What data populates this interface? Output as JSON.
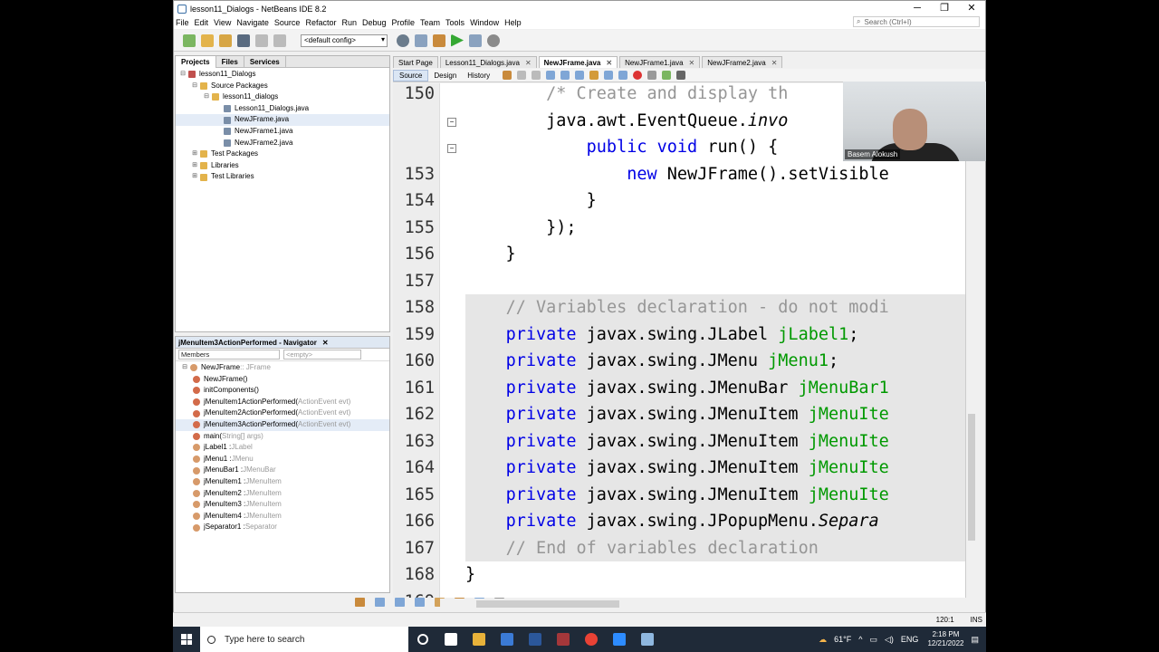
{
  "window": {
    "title": "lesson11_Dialogs - NetBeans IDE 8.2",
    "search_placeholder": "Search (Ctrl+I)"
  },
  "menu": [
    "File",
    "Edit",
    "View",
    "Navigate",
    "Source",
    "Refactor",
    "Run",
    "Debug",
    "Profile",
    "Team",
    "Tools",
    "Window",
    "Help"
  ],
  "toolbar": {
    "config": "<default config>"
  },
  "projects_panel": {
    "tabs": [
      "Projects",
      "Files",
      "Services"
    ],
    "tree": [
      {
        "label": "lesson11_Dialogs",
        "indent": 0,
        "fold": "⊟",
        "icon": "project-icon"
      },
      {
        "label": "Source Packages",
        "indent": 1,
        "fold": "⊟",
        "icon": "folder-icon"
      },
      {
        "label": "lesson11_dialogs",
        "indent": 2,
        "fold": "⊟",
        "icon": "package-icon"
      },
      {
        "label": "Lesson11_Dialogs.java",
        "indent": 3,
        "fold": "",
        "icon": "java-file-icon"
      },
      {
        "label": "NewJFrame.java",
        "indent": 3,
        "fold": "",
        "icon": "form-file-icon",
        "selected": true
      },
      {
        "label": "NewJFrame1.java",
        "indent": 3,
        "fold": "",
        "icon": "form-file-icon"
      },
      {
        "label": "NewJFrame2.java",
        "indent": 3,
        "fold": "",
        "icon": "form-file-icon"
      },
      {
        "label": "Test Packages",
        "indent": 1,
        "fold": "⊞",
        "icon": "folder-icon"
      },
      {
        "label": "Libraries",
        "indent": 1,
        "fold": "⊞",
        "icon": "library-icon"
      },
      {
        "label": "Test Libraries",
        "indent": 1,
        "fold": "⊞",
        "icon": "library-icon"
      }
    ]
  },
  "navigator": {
    "title": "jMenuItem3ActionPerformed - Navigator",
    "filter": "Members",
    "search_placeholder": "<empty>",
    "items": [
      {
        "name": "NewJFrame",
        "type": " :: JFrame",
        "indent": 0
      },
      {
        "name": "NewJFrame()",
        "type": "",
        "indent": 1
      },
      {
        "name": "initComponents()",
        "type": "",
        "indent": 1
      },
      {
        "name": "jMenuItem1ActionPerformed(",
        "type": "ActionEvent evt)",
        "indent": 1
      },
      {
        "name": "jMenuItem2ActionPerformed(",
        "type": "ActionEvent evt)",
        "indent": 1
      },
      {
        "name": "jMenuItem3ActionPerformed(",
        "type": "ActionEvent evt)",
        "indent": 1,
        "selected": true
      },
      {
        "name": "main(",
        "type": "String[] args)",
        "indent": 1
      },
      {
        "name": "jLabel1 : ",
        "type": "JLabel",
        "indent": 1
      },
      {
        "name": "jMenu1 : ",
        "type": "JMenu",
        "indent": 1
      },
      {
        "name": "jMenuBar1 : ",
        "type": "JMenuBar",
        "indent": 1
      },
      {
        "name": "jMenuItem1 : ",
        "type": "JMenuItem",
        "indent": 1
      },
      {
        "name": "jMenuItem2 : ",
        "type": "JMenuItem",
        "indent": 1
      },
      {
        "name": "jMenuItem3 : ",
        "type": "JMenuItem",
        "indent": 1
      },
      {
        "name": "jMenuItem4 : ",
        "type": "JMenuItem",
        "indent": 1
      },
      {
        "name": "jSeparator1 : ",
        "type": "Separator",
        "indent": 1
      }
    ]
  },
  "editor": {
    "tabs": [
      {
        "label": "Start Page",
        "close": false
      },
      {
        "label": "Lesson11_Dialogs.java",
        "close": true
      },
      {
        "label": "NewJFrame.java",
        "close": true,
        "active": true
      },
      {
        "label": "NewJFrame1.java",
        "close": true
      },
      {
        "label": "NewJFrame2.java",
        "close": true
      }
    ],
    "views": [
      "Source",
      "Design",
      "History"
    ],
    "lines": [
      {
        "n": "150",
        "hl": false,
        "parts": [
          [
            "",
            "        "
          ],
          [
            "cm",
            "/* Create and display th"
          ]
        ]
      },
      {
        "n": "",
        "hl": false,
        "parts": [
          [
            "",
            "        java.awt.EventQueue."
          ],
          [
            "it",
            "invo"
          ]
        ]
      },
      {
        "n": "",
        "hl": false,
        "parts": [
          [
            "",
            "            "
          ],
          [
            "kw",
            "public void "
          ],
          [
            "",
            "run() {"
          ]
        ]
      },
      {
        "n": "153",
        "hl": false,
        "parts": [
          [
            "",
            "                "
          ],
          [
            "kw",
            "new "
          ],
          [
            "",
            "NewJFrame().setVisible"
          ]
        ]
      },
      {
        "n": "154",
        "hl": false,
        "parts": [
          [
            "",
            "            }"
          ]
        ]
      },
      {
        "n": "155",
        "hl": false,
        "parts": [
          [
            "",
            "        });"
          ]
        ]
      },
      {
        "n": "156",
        "hl": false,
        "parts": [
          [
            "",
            "    }"
          ]
        ]
      },
      {
        "n": "157",
        "hl": false,
        "parts": [
          [
            "",
            ""
          ]
        ]
      },
      {
        "n": "158",
        "hl": true,
        "parts": [
          [
            "",
            "    "
          ],
          [
            "cm",
            "// Variables declaration - do not modi"
          ]
        ]
      },
      {
        "n": "159",
        "hl": true,
        "parts": [
          [
            "",
            "    "
          ],
          [
            "kw",
            "private "
          ],
          [
            "",
            "javax.swing.JLabel "
          ],
          [
            "fld",
            "jLabel1"
          ],
          [
            "",
            ";"
          ]
        ]
      },
      {
        "n": "160",
        "hl": true,
        "parts": [
          [
            "",
            "    "
          ],
          [
            "kw",
            "private "
          ],
          [
            "",
            "javax.swing.JMenu "
          ],
          [
            "fld",
            "jMenu1"
          ],
          [
            "",
            ";"
          ]
        ]
      },
      {
        "n": "161",
        "hl": true,
        "parts": [
          [
            "",
            "    "
          ],
          [
            "kw",
            "private "
          ],
          [
            "",
            "javax.swing.JMenuBar "
          ],
          [
            "fld",
            "jMenuBar1"
          ]
        ]
      },
      {
        "n": "162",
        "hl": true,
        "parts": [
          [
            "",
            "    "
          ],
          [
            "kw",
            "private "
          ],
          [
            "",
            "javax.swing.JMenuItem "
          ],
          [
            "fld",
            "jMenuIte"
          ]
        ]
      },
      {
        "n": "163",
        "hl": true,
        "parts": [
          [
            "",
            "    "
          ],
          [
            "kw",
            "private "
          ],
          [
            "",
            "javax.swing.JMenuItem "
          ],
          [
            "fld",
            "jMenuIte"
          ]
        ]
      },
      {
        "n": "164",
        "hl": true,
        "parts": [
          [
            "",
            "    "
          ],
          [
            "kw",
            "private "
          ],
          [
            "",
            "javax.swing.JMenuItem "
          ],
          [
            "fld",
            "jMenuIte"
          ]
        ]
      },
      {
        "n": "165",
        "hl": true,
        "parts": [
          [
            "",
            "    "
          ],
          [
            "kw",
            "private "
          ],
          [
            "",
            "javax.swing.JMenuItem "
          ],
          [
            "fld",
            "jMenuIte"
          ]
        ]
      },
      {
        "n": "166",
        "hl": true,
        "parts": [
          [
            "",
            "    "
          ],
          [
            "kw",
            "private "
          ],
          [
            "",
            "javax.swing.JPopupMenu."
          ],
          [
            "it",
            "Separa"
          ]
        ]
      },
      {
        "n": "167",
        "hl": true,
        "parts": [
          [
            "",
            "    "
          ],
          [
            "cm",
            "// End of variables declaration"
          ]
        ]
      },
      {
        "n": "168",
        "hl": false,
        "parts": [
          [
            "",
            "}"
          ]
        ]
      },
      {
        "n": "169",
        "hl": false,
        "parts": [
          [
            "",
            ""
          ]
        ]
      }
    ]
  },
  "status": {
    "position": "120:1",
    "mode": "INS"
  },
  "webcam": {
    "name": "Basem Alokush"
  },
  "taskbar": {
    "search_placeholder": "Type here to search",
    "weather": "61°F",
    "lang": "ENG",
    "time": "2:18 PM",
    "date": "12/21/2022",
    "apps": [
      "cortana-icon",
      "task-view-icon",
      "file-explorer-icon",
      "store-icon",
      "word-icon",
      "access-icon",
      "chrome-icon",
      "zoom-icon",
      "netbeans-icon"
    ]
  },
  "colors": {
    "keyword": "#0000e6",
    "comment": "#969696",
    "field": "#009900",
    "highlight": "#e6e6e6"
  }
}
